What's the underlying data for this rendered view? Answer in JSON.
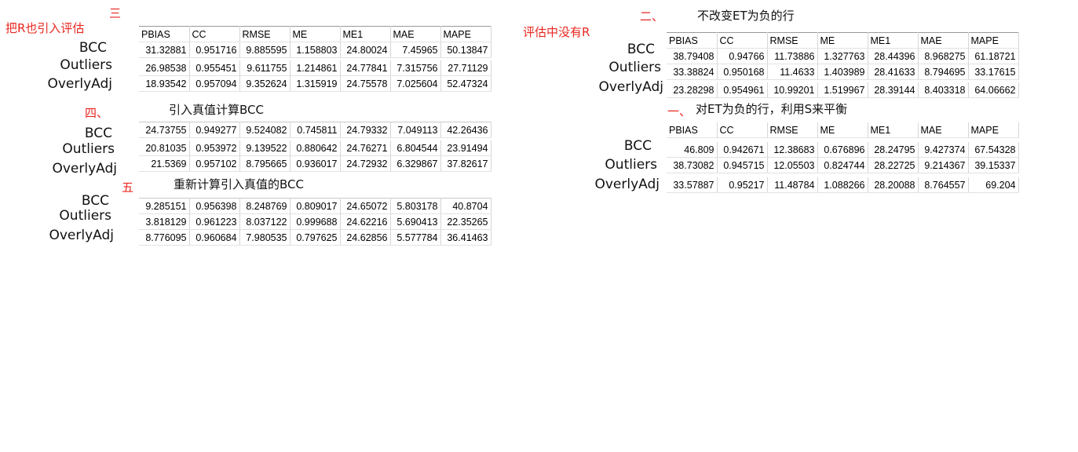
{
  "notes": {
    "note1": "把R也引入评估",
    "note2": "评估中没有R"
  },
  "section_san": {
    "number": "三",
    "headers": [
      "PBIAS",
      "CC",
      "RMSE",
      "ME",
      "ME1",
      "MAE",
      "MAPE"
    ],
    "row_labels": [
      "BCC",
      "Outliers",
      "OverlyAdj"
    ],
    "rows": [
      [
        "31.32881",
        "0.951716",
        "9.885595",
        "1.158803",
        "24.80024",
        "7.45965",
        "50.13847"
      ],
      [
        "26.98538",
        "0.955451",
        "9.611755",
        "1.214861",
        "24.77841",
        "7.315756",
        "27.71129"
      ],
      [
        "18.93542",
        "0.957094",
        "9.352624",
        "1.315919",
        "24.75578",
        "7.025604",
        "52.47324"
      ]
    ]
  },
  "section_si": {
    "number": "四、",
    "title": "引入真值计算BCC",
    "row_labels": [
      "BCC",
      "Outliers",
      "OverlyAdj"
    ],
    "rows": [
      [
        "24.73755",
        "0.949277",
        "9.524082",
        "0.745811",
        "24.79332",
        "7.049113",
        "42.26436"
      ],
      [
        "20.81035",
        "0.953972",
        "9.139522",
        "0.880642",
        "24.76271",
        "6.804544",
        "23.91494"
      ],
      [
        "21.5369",
        "0.957102",
        "8.795665",
        "0.936017",
        "24.72932",
        "6.329867",
        "37.82617"
      ]
    ]
  },
  "section_wu": {
    "number": "五",
    "title": "重新计算引入真值的BCC",
    "row_labels": [
      "BCC",
      "Outliers",
      "OverlyAdj"
    ],
    "rows": [
      [
        "9.285151",
        "0.956398",
        "8.248769",
        "0.809017",
        "24.65072",
        "5.803178",
        "40.8704"
      ],
      [
        "3.818129",
        "0.961223",
        "8.037122",
        "0.999688",
        "24.62216",
        "5.690413",
        "22.35265"
      ],
      [
        "8.776095",
        "0.960684",
        "7.980535",
        "0.797625",
        "24.62856",
        "5.577784",
        "36.41463"
      ]
    ]
  },
  "section_er": {
    "number": "二、",
    "title": "不改变ET为负的行",
    "headers": [
      "PBIAS",
      "CC",
      "RMSE",
      "ME",
      "ME1",
      "MAE",
      "MAPE"
    ],
    "row_labels": [
      "BCC",
      "Outliers",
      "OverlyAdj"
    ],
    "rows": [
      [
        "38.79408",
        "0.94766",
        "11.73886",
        "1.327763",
        "28.44396",
        "8.968275",
        "61.18721"
      ],
      [
        "33.38824",
        "0.950168",
        "11.4633",
        "1.403989",
        "28.41633",
        "8.794695",
        "33.17615"
      ],
      [
        "23.28298",
        "0.954961",
        "10.99201",
        "1.519967",
        "28.39144",
        "8.403318",
        "64.06662"
      ]
    ]
  },
  "section_yi": {
    "number": "一、",
    "title": "对ET为负的行，利用S来平衡",
    "headers": [
      "PBIAS",
      "CC",
      "RMSE",
      "ME",
      "ME1",
      "MAE",
      "MAPE"
    ],
    "row_labels": [
      "BCC",
      "Outliers",
      "OverlyAdj"
    ],
    "rows": [
      [
        "46.809",
        "0.942671",
        "12.38683",
        "0.676896",
        "28.24795",
        "9.427374",
        "67.54328"
      ],
      [
        "38.73082",
        "0.945715",
        "12.05503",
        "0.824744",
        "28.22725",
        "9.214367",
        "39.15337"
      ],
      [
        "33.57887",
        "0.95217",
        "11.48784",
        "1.088266",
        "28.20088",
        "8.764557",
        "69.204"
      ]
    ]
  }
}
